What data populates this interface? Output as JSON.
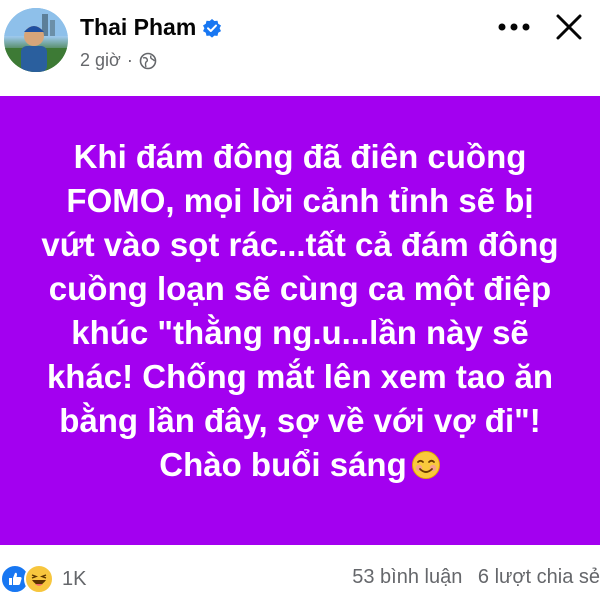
{
  "post": {
    "author": "Thai Pham",
    "time": "2 giờ",
    "text": "Khi đám đông đã điên cuồng FOMO, mọi lời cảnh tỉnh sẽ bị vứt vào sọt rác...tất cả đám đông cuồng loạn sẽ cùng ca một điệp khúc \"thằng ng.u...lần này sẽ khác! Chống mắt lên xem tao ăn bằng lần đây, sợ về với vợ đi\"! Chào buổi sáng",
    "background_color": "#a300f0"
  },
  "footer": {
    "reaction_count": "1K",
    "comments": "53 bình luận",
    "shares": "6 lượt chia sẻ"
  },
  "icons": {
    "verified": "verified-badge-icon",
    "privacy": "globe-icon",
    "more": "more-options-icon",
    "close": "close-icon",
    "emoji": "smiling-face-emoji",
    "reactions": [
      "like-reaction-icon",
      "haha-reaction-icon"
    ]
  }
}
